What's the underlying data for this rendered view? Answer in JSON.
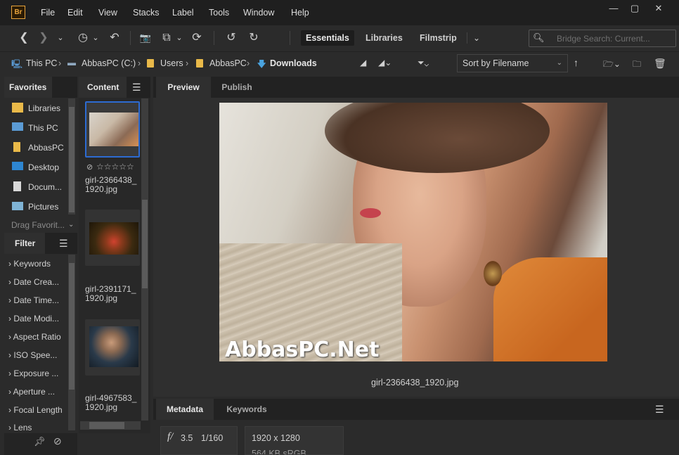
{
  "app": {
    "logo": "Br"
  },
  "menu": [
    "File",
    "Edit",
    "View",
    "Stacks",
    "Label",
    "Tools",
    "Window",
    "Help"
  ],
  "window_controls": {
    "minimize": "—",
    "maximize": "▢",
    "close": "✕"
  },
  "toolbar": {
    "back": "❮",
    "forward": "❯",
    "history": "◷",
    "boomerang": "↶",
    "camera": "📷",
    "copy": "⧉",
    "refresh": "⟳",
    "undo": "↺",
    "redo": "↻",
    "workspaces": [
      "Essentials",
      "Libraries",
      "Filmstrip"
    ],
    "more": "⌄",
    "search_placeholder": "Bridge Search: Current..."
  },
  "breadcrumbs": [
    "This PC",
    "AbbasPC (C:)",
    "Users",
    "AbbasPC",
    "Downloads"
  ],
  "sort": {
    "label": "Sort by Filename",
    "arrow": "↑"
  },
  "panels": {
    "favorites": "Favorites",
    "content": "Content",
    "filter": "Filter",
    "preview": "Preview",
    "publish": "Publish",
    "metadata": "Metadata",
    "keywords": "Keywords"
  },
  "favorites": [
    "Libraries",
    "This PC",
    "AbbasPC",
    "Desktop",
    "Docum...",
    "Pictures"
  ],
  "favorites_drag": "Drag Favorit...",
  "filters": [
    "Keywords",
    "Date Crea...",
    "Date Time...",
    "Date Modi...",
    "Aspect Ratio",
    "ISO Spee...",
    "Exposure ...",
    "Aperture ...",
    "Focal Length",
    "Lens"
  ],
  "files": [
    {
      "name1": "girl-2366438_",
      "name2": "1920.jpg"
    },
    {
      "name1": "girl-2391171_",
      "name2": "1920.jpg"
    },
    {
      "name1": "girl-4967583_",
      "name2": "1920.jpg"
    }
  ],
  "rating": "☆☆☆☆☆",
  "preview": {
    "watermark": "AbbasPC.Net",
    "caption": "girl-2366438_1920.jpg"
  },
  "metadata": {
    "fstop_symbol": "f/",
    "aperture": "3.5",
    "shutter": "1/160",
    "dimensions": "1920 x 1280",
    "sub": "564 KB    sRGB"
  }
}
